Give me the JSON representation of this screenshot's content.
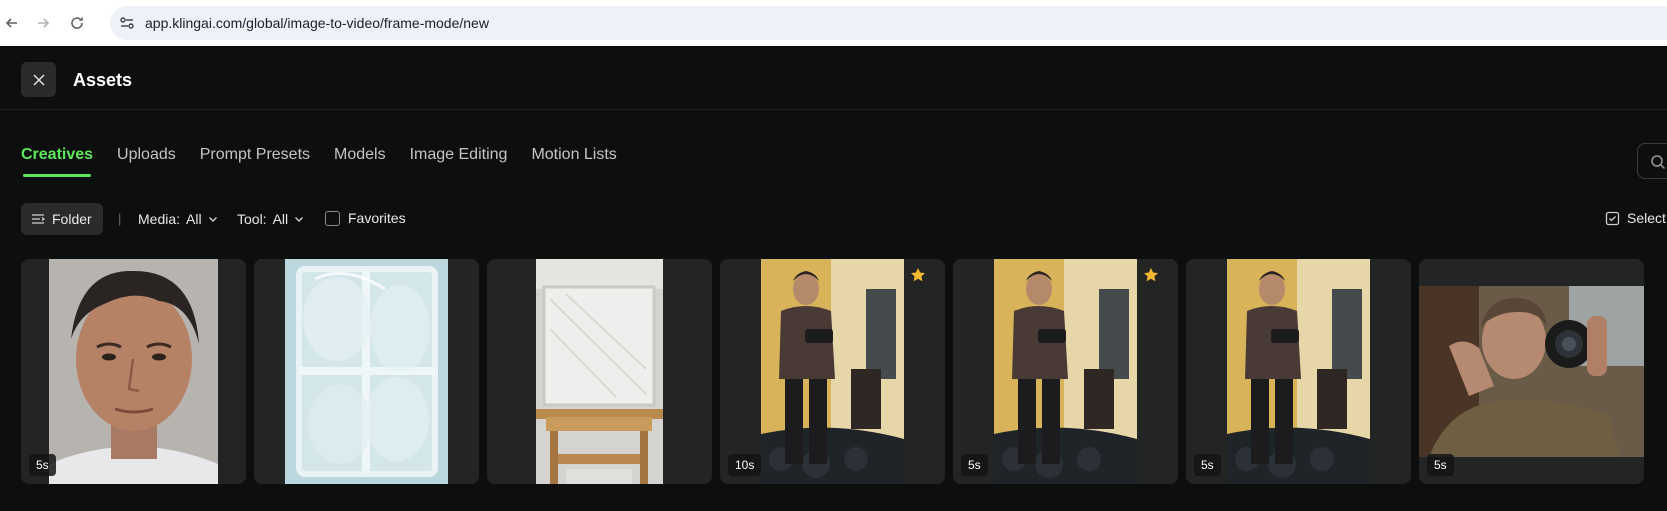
{
  "browser": {
    "url": "app.klingai.com/global/image-to-video/frame-mode/new"
  },
  "header": {
    "title": "Assets"
  },
  "tabs": [
    {
      "label": "Creatives",
      "active": true
    },
    {
      "label": "Uploads",
      "active": false
    },
    {
      "label": "Prompt Presets",
      "active": false
    },
    {
      "label": "Models",
      "active": false
    },
    {
      "label": "Image Editing",
      "active": false
    },
    {
      "label": "Motion Lists",
      "active": false
    }
  ],
  "filters": {
    "folder_label": "Folder",
    "separator": "|",
    "media_label": "Media:",
    "media_value": "All",
    "tool_label": "Tool:",
    "tool_value": "All",
    "favorites_label": "Favorites",
    "select_label": "Select"
  },
  "assets": [
    {
      "duration": "5s",
      "favorite": false,
      "subject": "man-portrait-headshot"
    },
    {
      "duration": "",
      "favorite": false,
      "subject": "plastic-wrapped-window"
    },
    {
      "duration": "",
      "favorite": false,
      "subject": "wrapped-canvas-on-easel"
    },
    {
      "duration": "10s",
      "favorite": true,
      "subject": "man-with-camera-standing"
    },
    {
      "duration": "5s",
      "favorite": true,
      "subject": "man-with-camera-standing"
    },
    {
      "duration": "5s",
      "favorite": false,
      "subject": "man-with-camera-standing"
    },
    {
      "duration": "5s",
      "favorite": false,
      "subject": "man-holding-camera-closeup"
    }
  ],
  "colors": {
    "accent": "#5ce65c",
    "background": "#0d0e0e",
    "card": "#232525",
    "star": "#f5b82e"
  }
}
